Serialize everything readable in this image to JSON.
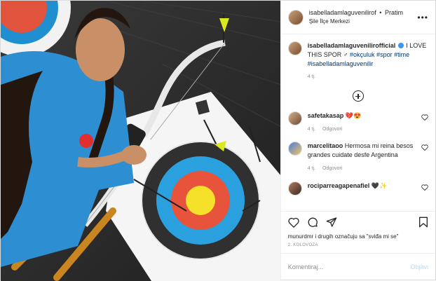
{
  "header": {
    "username": "isabelladamlaguvenilirof",
    "separator": "•",
    "follow_label": "Pratim",
    "location": "Şile İlçe Merkezi",
    "more_icon": "more-horizontal-icon"
  },
  "caption": {
    "username": "isabelladamlaguvenilirofficial",
    "text": "I LOVE THIS SPOR",
    "gender_symbol": "♂",
    "tags": [
      "#okçuluk",
      "#spor",
      "#time",
      "#isabelladamlaguvenilir"
    ],
    "time": "4 tj."
  },
  "comments": [
    {
      "username": "safetakasap",
      "text": "💔😍",
      "time": "4 tj.",
      "reply_label": "Odgovori"
    },
    {
      "username": "marcelitaoo",
      "text": "Hermosa mi reina besos grandes cuidate desfe Argentina",
      "time": "4 tj.",
      "reply_label": "Odgovori"
    },
    {
      "username": "rociparreagapenafiel",
      "text": "🖤✨",
      "time": "",
      "reply_label": ""
    }
  ],
  "likes": {
    "text": "munurdmr i drugih označuju sa \"sviđa mi se\""
  },
  "date": "2. KOLOVOZA",
  "add_comment": {
    "placeholder": "Komentiraj...",
    "post_label": "Objavi"
  },
  "colors": {
    "link": "#00376b",
    "verified": "#3897f0",
    "post_button": "#b2dffc",
    "muted": "#8e8e8e"
  }
}
